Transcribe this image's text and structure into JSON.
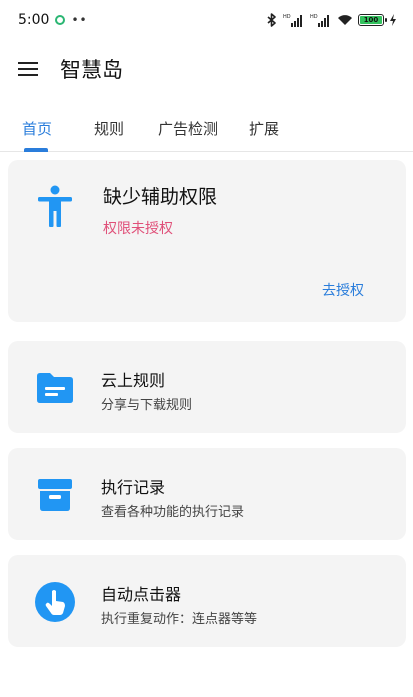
{
  "status_bar": {
    "time": "5:00",
    "dots": "••",
    "network_1": "HD",
    "network_2": "HD",
    "battery_level": 100,
    "battery_text": "100"
  },
  "app_bar": {
    "title": "智慧岛"
  },
  "tabs": [
    {
      "label": "首页",
      "active": true
    },
    {
      "label": "规则",
      "active": false
    },
    {
      "label": "广告检测",
      "active": false
    },
    {
      "label": "扩展",
      "active": false
    }
  ],
  "permission_card": {
    "title": "缺少辅助权限",
    "subtitle": "权限未授权",
    "action": "去授权",
    "icon": "accessibility-icon"
  },
  "features": [
    {
      "title": "云上规则",
      "subtitle": "分享与下载规则",
      "icon": "folder-icon"
    },
    {
      "title": "执行记录",
      "subtitle": "查看各种功能的执行记录",
      "icon": "archive-icon"
    },
    {
      "title": "自动点击器",
      "subtitle": "执行重复动作：连点器等等",
      "icon": "touch-icon"
    }
  ],
  "colors": {
    "accent": "#2a7ddb",
    "icon_blue": "#2196f3",
    "warning_pink": "#e05079",
    "card_bg": "#f4f4f4"
  }
}
